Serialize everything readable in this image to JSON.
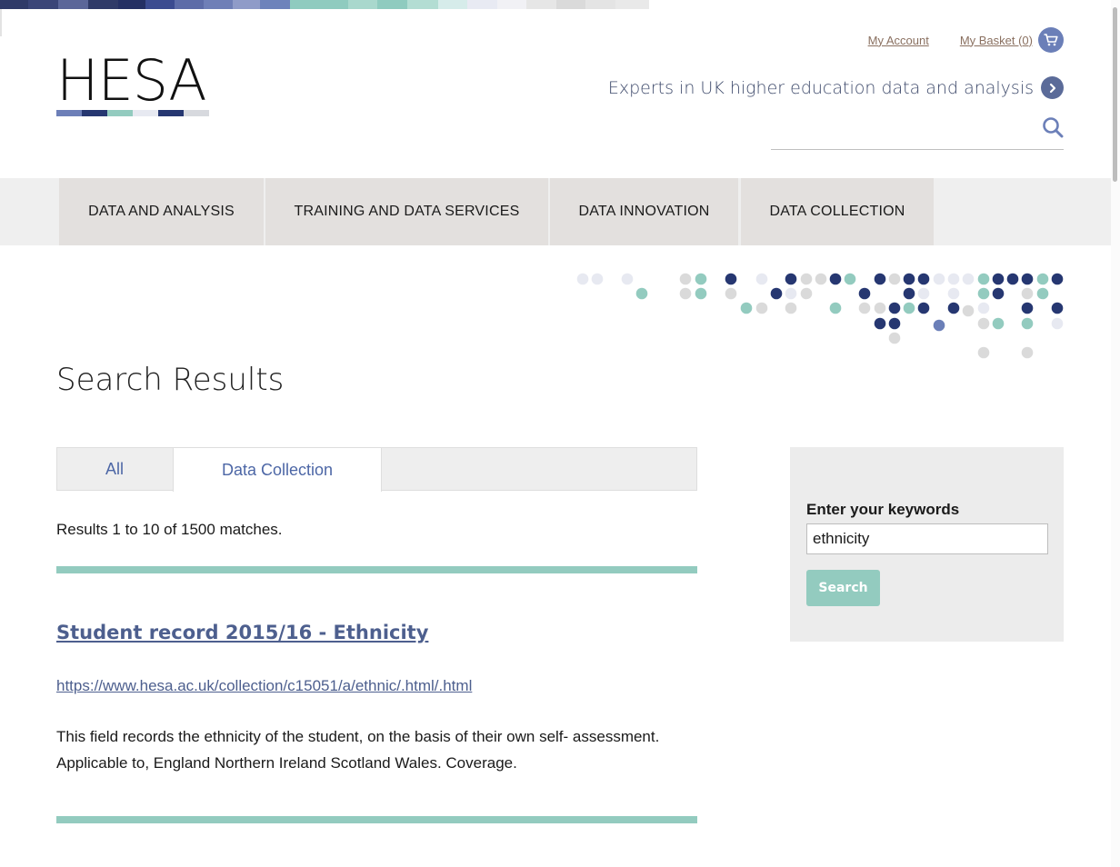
{
  "colors": {
    "strip": [
      "#2f3a68",
      "#3a4578",
      "#5b6699",
      "#2f3a68",
      "#243064",
      "#3b4b90",
      "#5d6ca8",
      "#6f7fb7",
      "#8f9bc8",
      "#6d83bb",
      "#8fcbbf",
      "#a9d8cd",
      "#8fcbbf",
      "#b3ddd3",
      "#d6ecea",
      "#e8eaf3",
      "#f1f1f5",
      "#e6e6e6",
      "#dadada",
      "#e4e4e4",
      "#e9e9e9"
    ],
    "logo_bars": [
      "#6d7fb8",
      "#263771",
      "#93cbbf",
      "#e7e9f1",
      "#263771",
      "#d7d9de"
    ],
    "accent_teal": "#93cbbf",
    "navy": "#263771",
    "link": "#4d5f8e"
  },
  "header": {
    "logo_text": "HESA",
    "my_account": "My Account",
    "my_basket": "My Basket (0)",
    "basket_icon": "shopping-cart-icon",
    "tagline": "Experts in UK higher education data and analysis",
    "tagline_icon": "chevron-right-icon",
    "search_icon": "magnifier-icon",
    "search_placeholder": ""
  },
  "nav": {
    "items": [
      {
        "label": "DATA AND ANALYSIS"
      },
      {
        "label": "TRAINING AND DATA SERVICES"
      },
      {
        "label": "DATA INNOVATION"
      },
      {
        "label": "DATA COLLECTION"
      }
    ]
  },
  "main": {
    "title": "Search Results",
    "tabs": [
      {
        "label": "All",
        "active": false
      },
      {
        "label": "Data Collection",
        "active": true
      }
    ],
    "results_count": "Results 1 to 10 of 1500 matches.",
    "results": [
      {
        "title": "Student record 2015/16 - Ethnicity",
        "url": "https://www.hesa.ac.uk/collection/c15051/a/ethnic/.html/.html",
        "description": "This field records the ethnicity of the student, on the basis of their own self- assessment. Applicable to, England Northern Ireland Scotland Wales. Coverage."
      }
    ]
  },
  "sidebar": {
    "keywords_label": "Enter your keywords",
    "keywords_value": "ethnicity",
    "search_button": "Search"
  }
}
